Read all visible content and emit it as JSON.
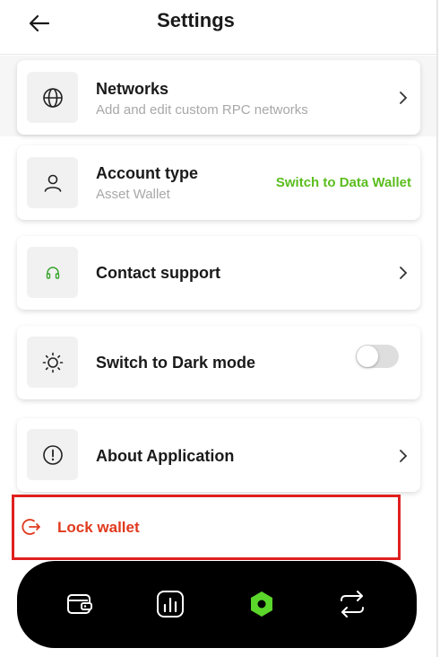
{
  "header": {
    "title": "Settings"
  },
  "items": [
    {
      "title": "Networks",
      "subtitle": "Add and edit custom RPC networks"
    },
    {
      "title": "Account type",
      "subtitle": "Asset Wallet",
      "action": "Switch to Data Wallet"
    },
    {
      "title": "Contact support"
    },
    {
      "title": "Switch to Dark mode",
      "toggle_on": false
    },
    {
      "title": "About Application"
    }
  ],
  "lock": {
    "label": "Lock wallet"
  },
  "colors": {
    "accent_green": "#5bbd1e",
    "danger": "#e03a1e",
    "nav_bg": "#000000"
  },
  "icons": {
    "networks": "globe-icon",
    "account": "user-icon",
    "support": "headphones-icon",
    "dark_mode": "sun-icon",
    "about": "info-icon",
    "lock": "logout-icon",
    "nav": [
      "wallet-icon",
      "chart-icon",
      "hexagon-icon",
      "swap-icon"
    ]
  },
  "nav": {
    "active_index": 2
  }
}
